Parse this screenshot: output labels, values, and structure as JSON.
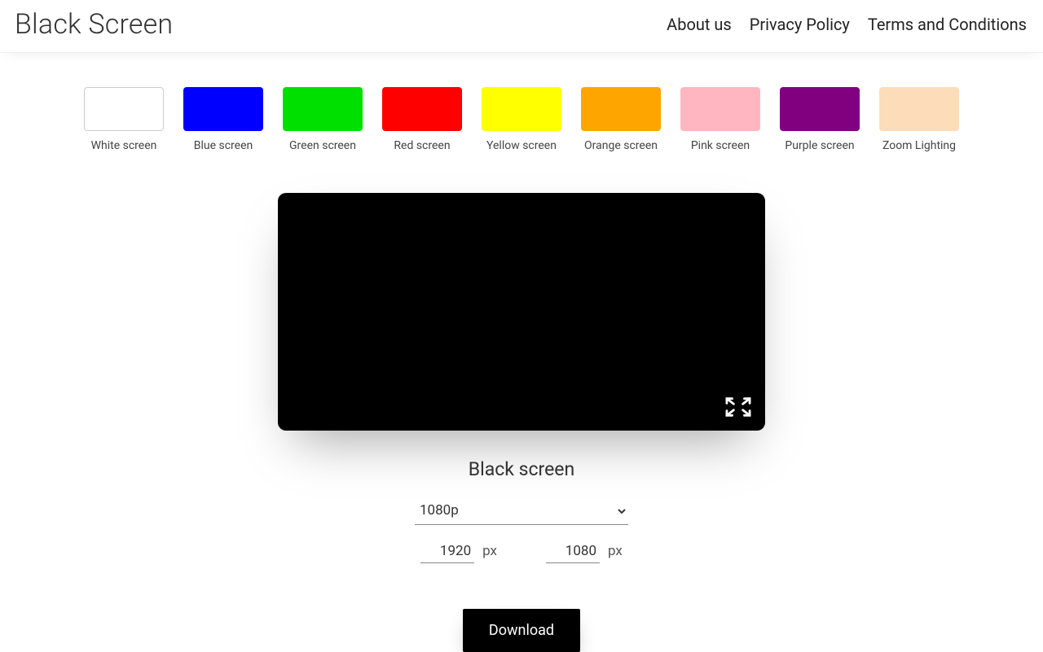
{
  "header": {
    "title": "Black Screen",
    "nav": [
      {
        "label": "About us"
      },
      {
        "label": "Privacy Policy"
      },
      {
        "label": "Terms and Conditions"
      }
    ]
  },
  "swatches": [
    {
      "label": "White screen",
      "color": "#ffffff",
      "bordered": true
    },
    {
      "label": "Blue screen",
      "color": "#0000ff",
      "bordered": false
    },
    {
      "label": "Green screen",
      "color": "#00e000",
      "bordered": false
    },
    {
      "label": "Red screen",
      "color": "#ff0000",
      "bordered": false
    },
    {
      "label": "Yellow screen",
      "color": "#ffff00",
      "bordered": false
    },
    {
      "label": "Orange screen",
      "color": "#ffa500",
      "bordered": false
    },
    {
      "label": "Pink screen",
      "color": "#ffb6c1",
      "bordered": false
    },
    {
      "label": "Purple screen",
      "color": "#800080",
      "bordered": false
    },
    {
      "label": "Zoom Lighting",
      "color": "#fddcba",
      "bordered": false
    }
  ],
  "preview": {
    "label": "Black screen",
    "background": "#000000"
  },
  "controls": {
    "resolution_selected": "1080p",
    "width_value": "1920",
    "height_value": "1080",
    "unit": "px",
    "download_label": "Download"
  }
}
